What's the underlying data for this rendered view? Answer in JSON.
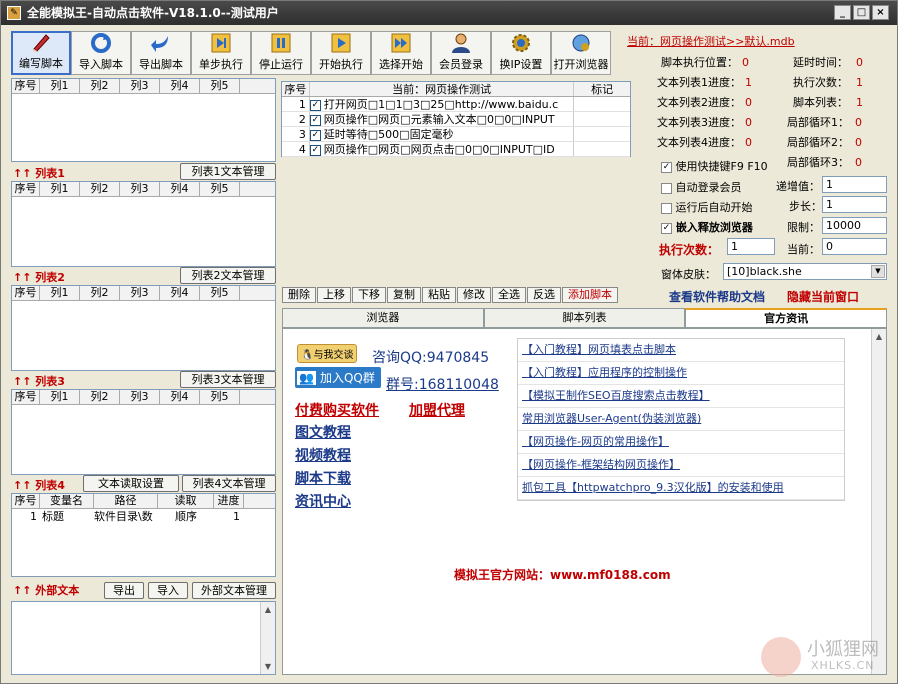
{
  "window": {
    "title": "全能模拟王-自动点击软件-V18.1.0--测试用户",
    "min": "_",
    "max": "□",
    "close": "×"
  },
  "toolbar": [
    {
      "label": "编写脚本",
      "icon": "pencil-icon"
    },
    {
      "label": "导入脚本",
      "icon": "refresh-icon"
    },
    {
      "label": "导出脚本",
      "icon": "export-arrow-icon"
    },
    {
      "label": "单步执行",
      "icon": "step-icon"
    },
    {
      "label": "停止运行",
      "icon": "pause-icon"
    },
    {
      "label": "开始执行",
      "icon": "play-icon"
    },
    {
      "label": "选择开始",
      "icon": "fast-forward-icon"
    },
    {
      "label": "会员登录",
      "icon": "user-icon"
    },
    {
      "label": "换IP设置",
      "icon": "gear-icon"
    },
    {
      "label": "打开浏览器",
      "icon": "browser-icon"
    }
  ],
  "left": {
    "grid_headers": [
      "序号",
      "列1",
      "列2",
      "列3",
      "列4",
      "列5"
    ],
    "list1": {
      "label": "列表1",
      "btn": "列表1文本管理"
    },
    "list2": {
      "label": "列表2",
      "btn": "列表2文本管理"
    },
    "list3": {
      "label": "列表3",
      "btn": "列表3文本管理"
    },
    "list4": {
      "label": "列表4",
      "btn_read": "文本读取设置",
      "btn": "列表4文本管理"
    },
    "var_headers": [
      "序号",
      "变量名",
      "路径",
      "读取",
      "进度"
    ],
    "var_row": [
      "1",
      "标题",
      "软件目录\\数",
      "顺序",
      "1"
    ],
    "external": {
      "label": "外部文本",
      "export": "导出",
      "import": "导入",
      "manage": "外部文本管理"
    }
  },
  "center": {
    "headers": [
      "序号",
      "当前：网页操作测试",
      "标记"
    ],
    "rows": [
      {
        "no": "1",
        "text": "打开网页□1□1□3□25□http://www.baidu.c"
      },
      {
        "no": "2",
        "text": "网页操作□网页□元素输入文本□0□0□INPUT"
      },
      {
        "no": "3",
        "text": "延时等待□500□固定毫秒"
      },
      {
        "no": "4",
        "text": "网页操作□网页□网页点击□0□0□INPUT□ID"
      }
    ],
    "ops": [
      "删除",
      "上移",
      "下移",
      "复制",
      "粘贴",
      "修改",
      "全选",
      "反选",
      "添加脚本"
    ]
  },
  "right": {
    "current_file": "当前：网页操作测试>>默认.mdb",
    "stats_left": [
      {
        "label": "脚本执行位置：",
        "value": "0"
      },
      {
        "label": "文本列表1进度：",
        "value": "1"
      },
      {
        "label": "文本列表2进度：",
        "value": "0"
      },
      {
        "label": "文本列表3进度：",
        "value": "0"
      },
      {
        "label": "文本列表4进度：",
        "value": "0"
      }
    ],
    "stats_right": [
      {
        "label": "延时时间：",
        "value": "0"
      },
      {
        "label": "执行次数：",
        "value": "1"
      },
      {
        "label": "脚本列表：",
        "value": "1"
      },
      {
        "label": "局部循环1：",
        "value": "0"
      },
      {
        "label": "局部循环2：",
        "value": "0"
      },
      {
        "label": "局部循环3：",
        "value": "0"
      }
    ],
    "hotkey": "使用快捷键F9 F10",
    "auto_login": "自动登录会员",
    "auto_start": "运行后自动开始",
    "embed_browser": "嵌入释放浏览器",
    "increment_label": "递增值：",
    "increment_value": "1",
    "step_label": "步长：",
    "step_value": "1",
    "limit_label": "限制：",
    "limit_value": "10000",
    "exec_label": "执行次数：",
    "exec_value": "1",
    "current_label": "当前：",
    "current_value": "0",
    "skin_label": "窗体皮肤：",
    "skin_value": "[10]black.she",
    "help_link": "查看软件帮助文档",
    "hide_link": "隐藏当前窗口"
  },
  "tabs": [
    "浏览器",
    "脚本列表",
    "官方资讯"
  ],
  "info": {
    "chat_badge": "与我交谈",
    "qq_contact": "咨询QQ:9470845",
    "qq_group_badge": "加入QQ群",
    "qq_group": "群号:168110048",
    "buy": "付费购买软件",
    "agent": "加盟代理",
    "links_left": [
      "图文教程",
      "视频教程",
      "脚本下载",
      "资讯中心"
    ],
    "links_right": [
      "【入门教程】网页填表点击脚本",
      "【入门教程】应用程序的控制操作",
      "【模拟王制作SEO百度搜索点击教程】",
      "常用浏览器User-Agent(伪装浏览器)",
      "【网页操作-网页的常用操作】",
      "【网页操作-框架结构网页操作】",
      "抓包工具【httpwatchpro_9.3汉化版】的安装和使用"
    ],
    "website": "模拟王官方网站：www.mf0188.com"
  },
  "watermark": {
    "cn": "小狐狸网",
    "en": "XHLKS.CN"
  }
}
